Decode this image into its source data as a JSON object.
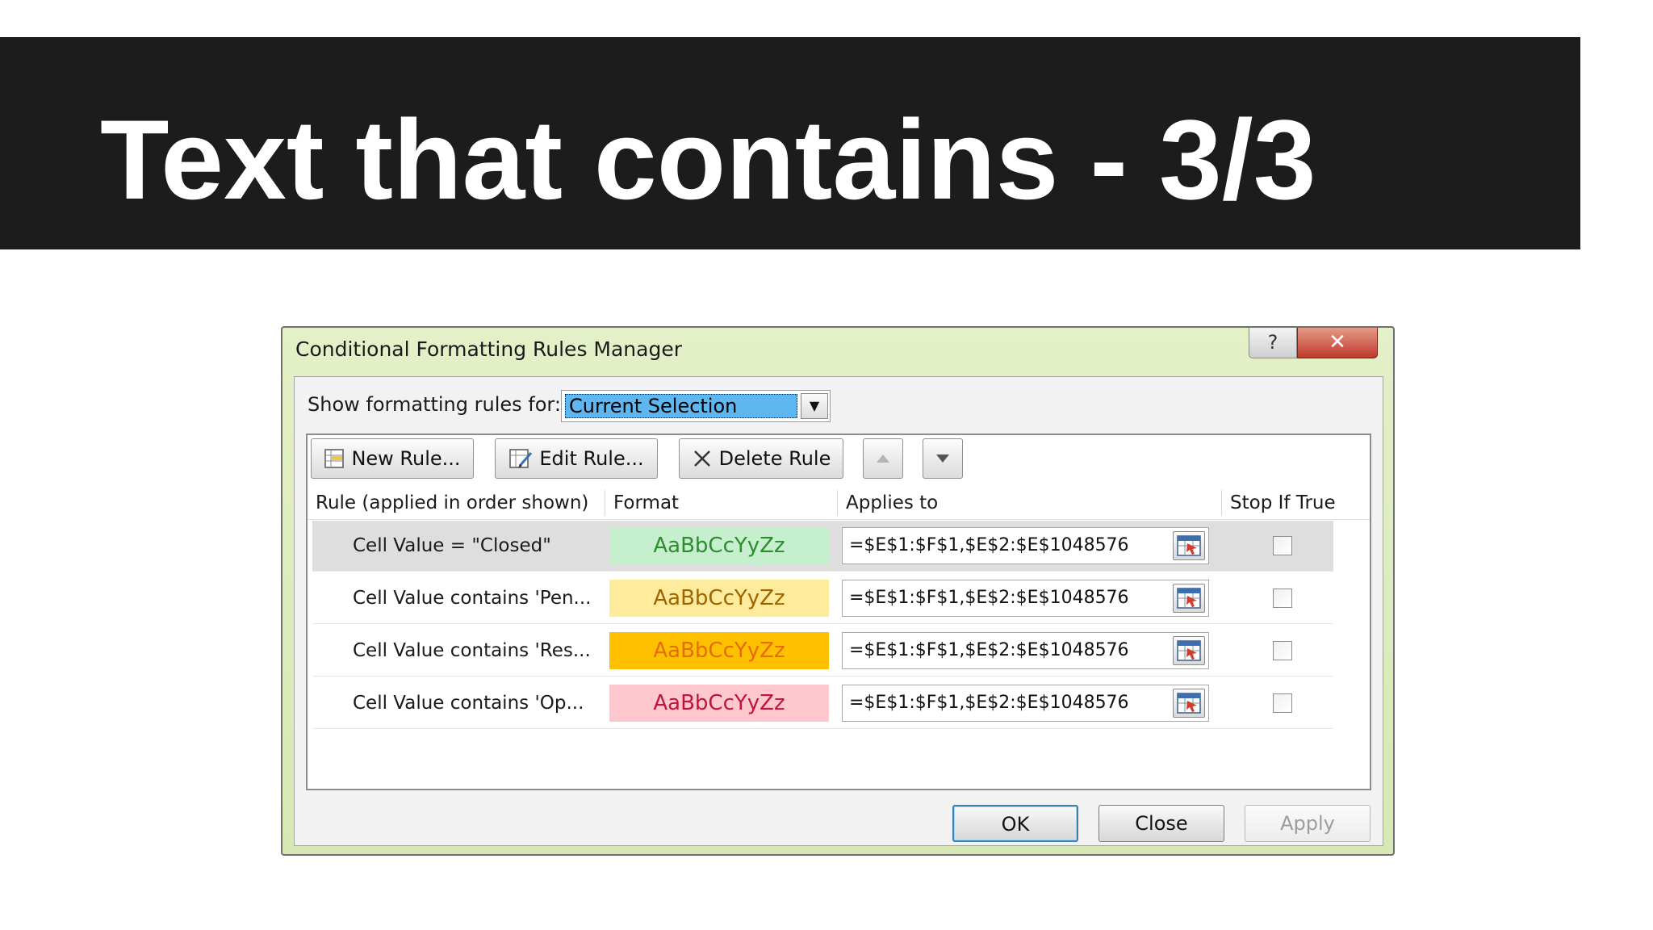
{
  "slide": {
    "title": "Text that contains - 3/3"
  },
  "dialog": {
    "title": "Conditional Formatting Rules Manager",
    "help_label": "?",
    "close_label": "✕",
    "show_label": "Show formatting rules for:",
    "show_value": "Current Selection",
    "toolbar": {
      "new_rule": "New Rule...",
      "edit_rule": "Edit Rule...",
      "delete_rule": "Delete Rule"
    },
    "columns": {
      "rule": "Rule (applied in order shown)",
      "format": "Format",
      "applies_to": "Applies to",
      "stop_if_true": "Stop If True"
    },
    "rules": [
      {
        "name": "Cell Value = \"Closed\"",
        "preview": "AaBbCcYyZz",
        "fill": "#c6efce",
        "font_color": "#2e8b2e",
        "applies_to": "=$E$1:$F$1,$E$2:$E$1048576",
        "stop_if_true": false
      },
      {
        "name": "Cell Value contains 'Pen...",
        "preview": "AaBbCcYyZz",
        "fill": "#ffeb9c",
        "font_color": "#9c6500",
        "applies_to": "=$E$1:$F$1,$E$2:$E$1048576",
        "stop_if_true": false
      },
      {
        "name": "Cell Value contains 'Res...",
        "preview": "AaBbCcYyZz",
        "fill": "#ffc000",
        "font_color": "#e46c0a",
        "applies_to": "=$E$1:$F$1,$E$2:$E$1048576",
        "stop_if_true": false
      },
      {
        "name": "Cell Value contains 'Op...",
        "preview": "AaBbCcYyZz",
        "fill": "#ffc7ce",
        "font_color": "#c0143c",
        "applies_to": "=$E$1:$F$1,$E$2:$E$1048576",
        "stop_if_true": false
      }
    ],
    "buttons": {
      "ok": "OK",
      "close": "Close",
      "apply": "Apply"
    }
  }
}
